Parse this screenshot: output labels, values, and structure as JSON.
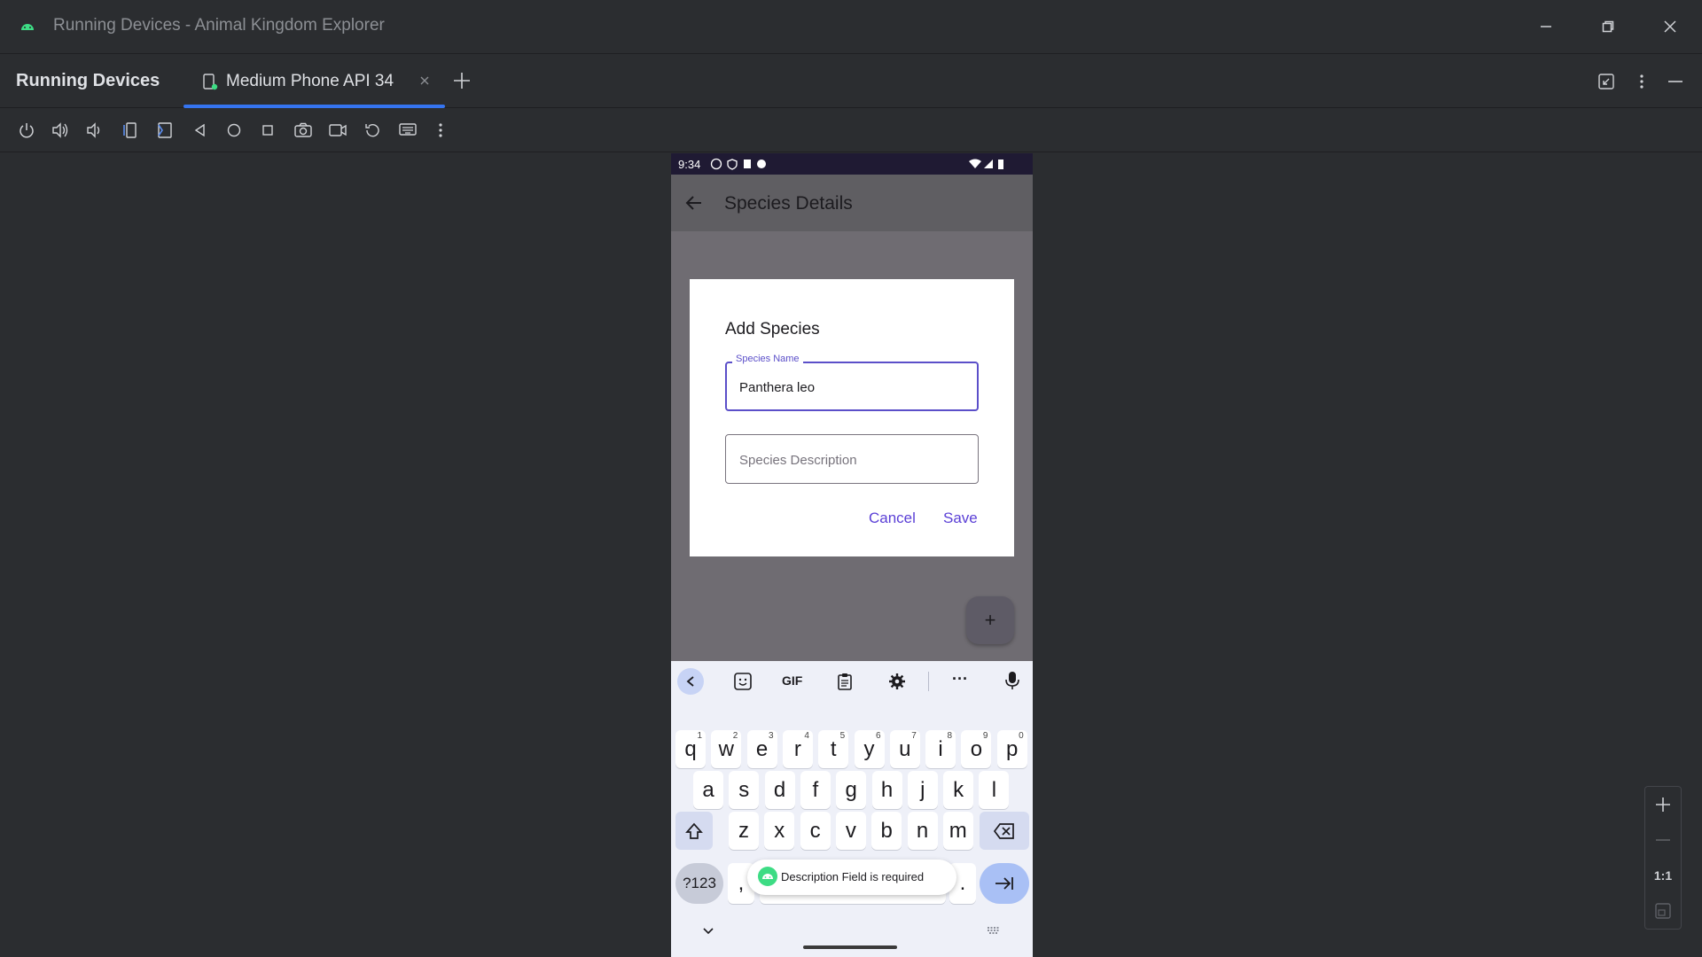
{
  "window": {
    "title": "Running Devices - Animal Kingdom Explorer",
    "controls": [
      "minimize-icon",
      "restore-icon",
      "close-icon"
    ]
  },
  "tool_window": {
    "title": "Running Devices",
    "tab": {
      "label": "Medium Phone API 34",
      "icon": "device-icon"
    },
    "header_actions": [
      "collapse-icon",
      "more-vertical-icon",
      "hide-icon"
    ]
  },
  "toolbar": {
    "buttons": [
      "power-icon",
      "volume-up-icon",
      "volume-down-icon",
      "rotate-left-icon",
      "rotate-right-icon",
      "back-icon",
      "home-icon",
      "overview-icon",
      "screenshot-icon",
      "screen-record-icon",
      "reset-icon",
      "keyboard-icon",
      "more-icon"
    ]
  },
  "phone": {
    "status_bar": {
      "time": "9:34"
    },
    "app_bar": {
      "title": "Species Details"
    },
    "dialog": {
      "title": "Add Species",
      "name_field": {
        "label": "Species Name",
        "value": "Panthera leo"
      },
      "description_field": {
        "placeholder": "Species Description"
      },
      "cancel_label": "Cancel",
      "save_label": "Save"
    },
    "fab_label": "+",
    "keyboard": {
      "suggestion_bar": {
        "gif_label": "GIF",
        "more_label": "···"
      },
      "row1": [
        {
          "k": "q",
          "h": "1"
        },
        {
          "k": "w",
          "h": "2"
        },
        {
          "k": "e",
          "h": "3"
        },
        {
          "k": "r",
          "h": "4"
        },
        {
          "k": "t",
          "h": "5"
        },
        {
          "k": "y",
          "h": "6"
        },
        {
          "k": "u",
          "h": "7"
        },
        {
          "k": "i",
          "h": "8"
        },
        {
          "k": "o",
          "h": "9"
        },
        {
          "k": "p",
          "h": "0"
        }
      ],
      "row2": [
        "a",
        "s",
        "d",
        "f",
        "g",
        "h",
        "j",
        "k",
        "l"
      ],
      "row3": [
        "z",
        "x",
        "c",
        "v",
        "b",
        "n",
        "m"
      ],
      "symbols_label": "?123",
      "comma_label": ",",
      "period_label": "."
    },
    "toast": {
      "text": "Description Field is required"
    }
  },
  "zoom_panel": {
    "one_to_one_label": "1:1"
  },
  "colors": {
    "accent": "#3574f0",
    "dialog_button": "#5a3fd6",
    "focused_field": "#5b4fc9"
  }
}
